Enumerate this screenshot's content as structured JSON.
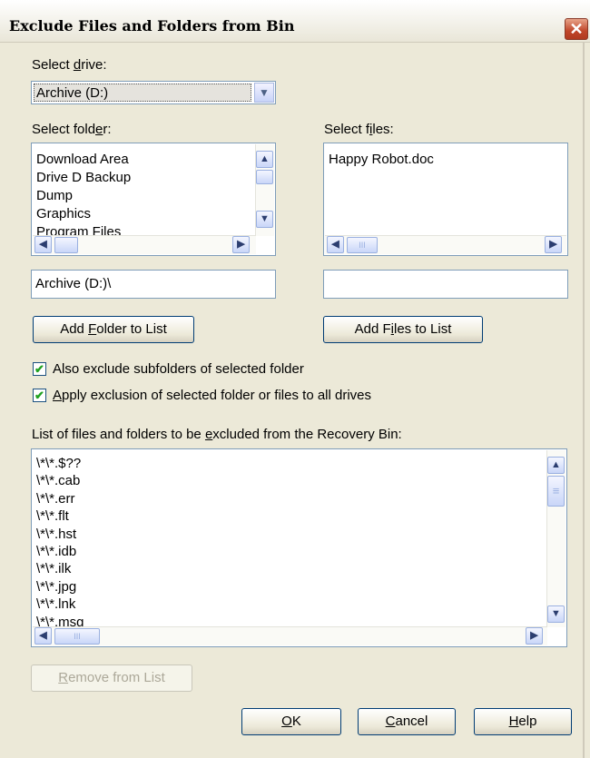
{
  "window": {
    "title": "Exclude Files and Folders from Bin",
    "close_glyph": "✕"
  },
  "drive": {
    "label_pre": "Select ",
    "label_u": "d",
    "label_post": "rive:",
    "value": "Archive (D:)"
  },
  "folder": {
    "label_pre": "Select fold",
    "label_u": "e",
    "label_post": "r:",
    "items": [
      "Download Area",
      "Drive D Backup",
      "Dump",
      "Graphics",
      "Program Files"
    ],
    "path_value": "Archive (D:)\\",
    "add_pre": "Add ",
    "add_u": "F",
    "add_post": "older to List"
  },
  "files": {
    "label_pre": "Select f",
    "label_u": "i",
    "label_post": "les:",
    "items": [
      "Happy Robot.doc"
    ],
    "path_value": "",
    "add_pre": "Add F",
    "add_u": "i",
    "add_post": "les to List"
  },
  "options": {
    "subfolders": "Also exclude subfolders of selected folder",
    "all_drives_u": "A",
    "all_drives_rest": "pply exclusion of selected folder or files to all drives",
    "subfolders_checked": true,
    "all_drives_checked": true
  },
  "exclusion": {
    "label_pre": "List of files and folders to be ",
    "label_u": "e",
    "label_post": "xcluded from the Recovery Bin:",
    "items": [
      "\\*\\*.$??",
      "\\*\\*.cab",
      "\\*\\*.err",
      "\\*\\*.flt",
      "\\*\\*.hst",
      "\\*\\*.idb",
      "\\*\\*.ilk",
      "\\*\\*.jpg",
      "\\*\\*.lnk",
      "\\*\\*.msg"
    ]
  },
  "buttons": {
    "remove_u": "R",
    "remove_rest": "emove from List",
    "ok_u": "O",
    "ok_rest": "K",
    "cancel_u": "C",
    "cancel_rest": "ancel",
    "help_u": "H",
    "help_rest": "elp"
  },
  "glyphs": {
    "check": "✔",
    "up": "▲",
    "down": "▼",
    "left": "◀",
    "right": "▶",
    "grip": "III",
    "vgrip": "≡"
  }
}
